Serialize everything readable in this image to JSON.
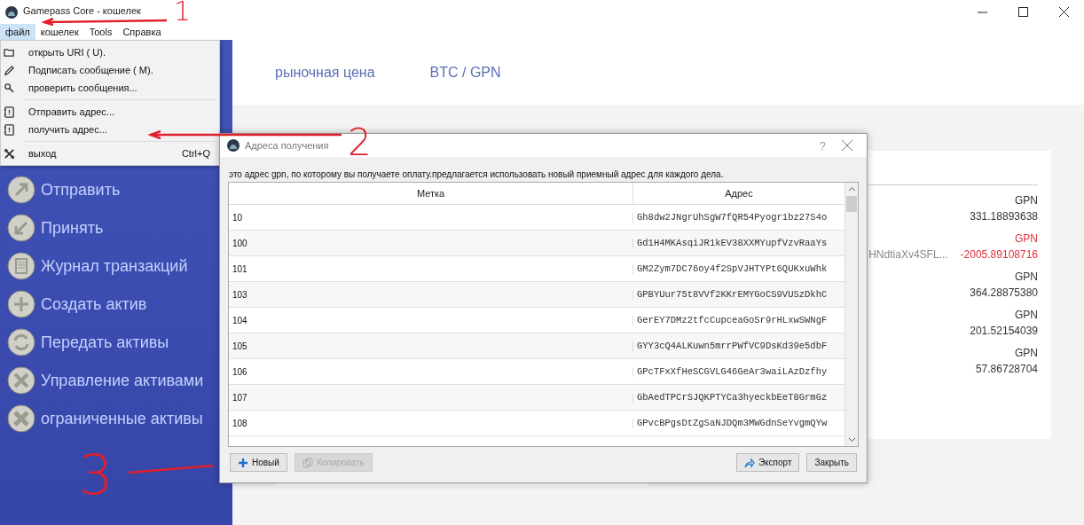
{
  "window": {
    "title": "Gamepass Core - кошелек"
  },
  "menu_bar": [
    {
      "label": "файл",
      "selected": true
    },
    {
      "label": "кошелек",
      "selected": false
    },
    {
      "label": "Tools",
      "selected": false
    },
    {
      "label": "Справка",
      "selected": false
    }
  ],
  "file_menu": [
    {
      "kind": "item",
      "label": "открыть URI ( U)."
    },
    {
      "kind": "item",
      "label": "Подписать сообщение ( M)."
    },
    {
      "kind": "item",
      "label": "проверить сообщения..."
    },
    {
      "kind": "separator"
    },
    {
      "kind": "item",
      "label": "Отправить адрес..."
    },
    {
      "kind": "item",
      "label": "получить адрес..."
    },
    {
      "kind": "separator"
    },
    {
      "kind": "item",
      "label": "выход",
      "shortcut": "Ctrl+Q"
    }
  ],
  "sidebar": {
    "items": [
      {
        "label": "Отправить"
      },
      {
        "label": "Принять"
      },
      {
        "label": "Журнал транзакций"
      },
      {
        "label": "Создать актив"
      },
      {
        "label": "Передать активы"
      },
      {
        "label": "Управление активами"
      },
      {
        "label": "ограниченные активы"
      }
    ]
  },
  "header": {
    "tabs": [
      "рыночная цена",
      "BTC / GPN"
    ]
  },
  "balances": [
    {
      "currency": "GPN",
      "amount": "331.18893638",
      "negative": false
    },
    {
      "label": "HNdtiaXv4SFL...",
      "currency": "GPN",
      "amount": "-2005.89108716",
      "negative": true
    },
    {
      "currency": "GPN",
      "amount": "364.28875380",
      "negative": false
    },
    {
      "currency": "GPN",
      "amount": "201.52154039",
      "negative": false
    },
    {
      "currency": "GPN",
      "amount": "57.86728704",
      "negative": false
    }
  ],
  "dialog": {
    "title": "Адреса получения",
    "help": "?",
    "description": "это адрес gpn, по которому вы получаете оплату.предлагается использовать новый приемный адрес для каждого дела.",
    "table": {
      "columns": [
        "Метка",
        "Адрес"
      ],
      "rows": [
        {
          "label": "10",
          "address": "Gh8dw2JNgrUhSgW7fQR54Pyogr1bz27S4o"
        },
        {
          "label": "100",
          "address": "Gd1H4MKAsqiJR1kEV38XXMYupfVzvRaaYs"
        },
        {
          "label": "101",
          "address": "GM2Zym7DC76oy4f2SpVJHTYPt6QUKxuWhk"
        },
        {
          "label": "103",
          "address": "GPBYUur75t8VVf2KKrEMYGoCS9VUSzDkhC"
        },
        {
          "label": "104",
          "address": "GerEY7DMz2tfcCupceaGoSr9rHLxwSWNgF"
        },
        {
          "label": "105",
          "address": "GYY3cQ4ALKuwn5mrrPWfVC9DsKd39e5dbF"
        },
        {
          "label": "106",
          "address": "GPcTFxXfHeSCGVLG46GeAr3waiLAzDzfhy"
        },
        {
          "label": "107",
          "address": "GbAedTPCrSJQKPTYCa3hyeckbEeT8GrmGz"
        },
        {
          "label": "108",
          "address": "GPvcBPgsDtZgSaNJDQm3MWGdnSeYvgmQYw"
        }
      ]
    },
    "buttons": [
      {
        "label": "Новый",
        "disabled": false
      },
      {
        "label": "Копировать",
        "disabled": true
      },
      {
        "label": "Экспорт",
        "disabled": false
      },
      {
        "label": "Закрыть",
        "disabled": false
      }
    ]
  },
  "annotations": [
    {
      "label": "1"
    },
    {
      "label": "2"
    },
    {
      "label": "3"
    }
  ]
}
